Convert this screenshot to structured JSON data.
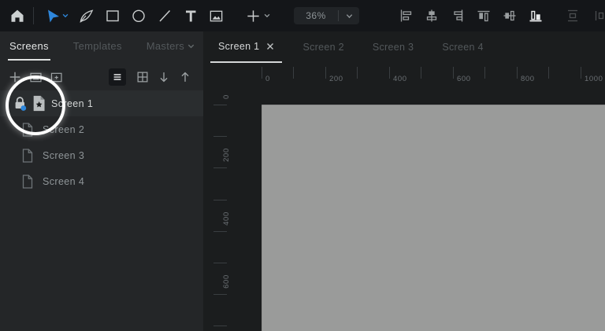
{
  "toolbar": {
    "zoom_value": "36%",
    "tool_icons": [
      "home",
      "select-arrow",
      "pen",
      "rectangle",
      "ellipse",
      "line",
      "text",
      "image",
      "insert-plus"
    ],
    "align_icons": [
      "align-left",
      "align-center-horizontal",
      "align-right",
      "align-top",
      "align-middle-vertical",
      "align-bottom",
      "distribute-vertical",
      "distribute-horizontal"
    ]
  },
  "sidebar": {
    "tabs": [
      {
        "label": "Screens",
        "active": true
      },
      {
        "label": "Templates",
        "active": false
      },
      {
        "label": "Masters",
        "active": false
      }
    ],
    "action_icons": [
      "add-screen",
      "add-image-screen",
      "add-folder",
      "list-view",
      "grid-view",
      "move-down",
      "move-up"
    ],
    "screens": [
      {
        "label": "Screen 1",
        "selected": true,
        "locked": true,
        "starred": true
      },
      {
        "label": "Screen 2",
        "selected": false
      },
      {
        "label": "Screen 3",
        "selected": false
      },
      {
        "label": "Screen 4",
        "selected": false
      }
    ]
  },
  "canvas": {
    "tabs": [
      {
        "label": "Screen 1",
        "active": true,
        "closable": true
      },
      {
        "label": "Screen 2",
        "active": false
      },
      {
        "label": "Screen 3",
        "active": false
      },
      {
        "label": "Screen 4",
        "active": false
      }
    ],
    "h_ruler_labels": [
      "0",
      "200",
      "400",
      "600",
      "800",
      "1000"
    ],
    "v_ruler_labels": [
      "0",
      "200",
      "400",
      "600"
    ]
  },
  "colors": {
    "accent_blue": "#2e87dc",
    "toolbar_bg": "#141619",
    "sidebar_bg": "#242628",
    "canvas_bg": "#1b1d1e",
    "artboard_gray": "#9a9b9a",
    "spotlight_ring": "#fdfdfd"
  }
}
